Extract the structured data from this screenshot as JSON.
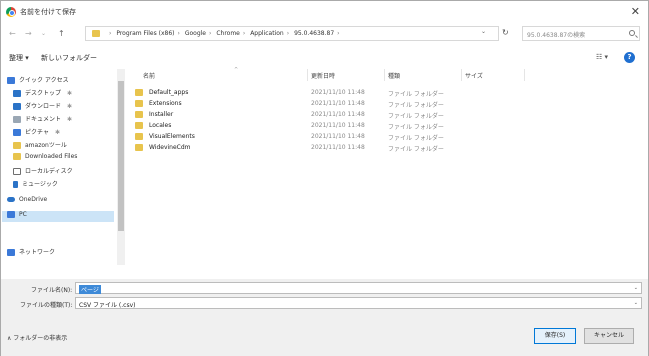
{
  "window": {
    "title": "名前を付けて保存"
  },
  "address": {
    "crumbs": [
      "Program Files (x86)",
      "Google",
      "Chrome",
      "Application",
      "95.0.4638.87"
    ],
    "search_placeholder": "95.0.4638.87の検索"
  },
  "toolbar": {
    "organize": "整理 ▾",
    "new_folder": "新しいフォルダー",
    "view": "☷ ▾"
  },
  "nav": {
    "items": [
      {
        "label": "クイック アクセス",
        "icon": "star-icon",
        "color": "#3b79d8"
      },
      {
        "label": "デスクトップ",
        "icon": "desktop-icon",
        "color": "#2b73c7",
        "pin": "✱"
      },
      {
        "label": "ダウンロード",
        "icon": "download-icon",
        "color": "#2b73c7",
        "pin": "✱"
      },
      {
        "label": "ドキュメント",
        "icon": "document-icon",
        "color": "#9aa7b4",
        "pin": "✱"
      },
      {
        "label": "ピクチャ",
        "icon": "pictures-icon",
        "color": "#3b79d8",
        "pin": "✱"
      },
      {
        "label": "amazonツール",
        "icon": "folder-icon",
        "color": "#e8c44d"
      },
      {
        "label": "Downloaded Files",
        "icon": "folder-icon",
        "color": "#e8c44d"
      },
      {
        "label": "ローカルディスク",
        "icon": "drive-icon",
        "color": "#6e6e6e"
      },
      {
        "label": "ミュージック",
        "icon": "music-icon",
        "color": "#2b73c7"
      },
      {
        "label": "OneDrive",
        "icon": "onedrive-icon",
        "color": "#2b73c7"
      },
      {
        "label": "PC",
        "icon": "pc-icon",
        "color": "#3b79d8"
      },
      {
        "label": "ネットワーク",
        "icon": "network-icon",
        "color": "#3b79d8"
      }
    ]
  },
  "columns": {
    "name": "名前",
    "date": "更新日時",
    "type": "種類",
    "size": "サイズ"
  },
  "files": [
    {
      "name": "Default_apps",
      "date": "2021/11/10 11:48",
      "type": "ファイル フォルダー"
    },
    {
      "name": "Extensions",
      "date": "2021/11/10 11:48",
      "type": "ファイル フォルダー"
    },
    {
      "name": "Installer",
      "date": "2021/11/10 11:48",
      "type": "ファイル フォルダー"
    },
    {
      "name": "Locales",
      "date": "2021/11/10 11:48",
      "type": "ファイル フォルダー"
    },
    {
      "name": "VisualElements",
      "date": "2021/11/10 11:48",
      "type": "ファイル フォルダー"
    },
    {
      "name": "WidevineCdm",
      "date": "2021/11/10 11:48",
      "type": "ファイル フォルダー"
    }
  ],
  "bottom": {
    "filename_label": "ファイル名(N):",
    "filename_value": "ページ",
    "filetype_label": "ファイルの種類(T):",
    "filetype_value": "CSV ファイル (.csv)",
    "hide_folders": "∧ フォルダーの非表示",
    "save": "保存(S)",
    "cancel": "キャンセル"
  }
}
